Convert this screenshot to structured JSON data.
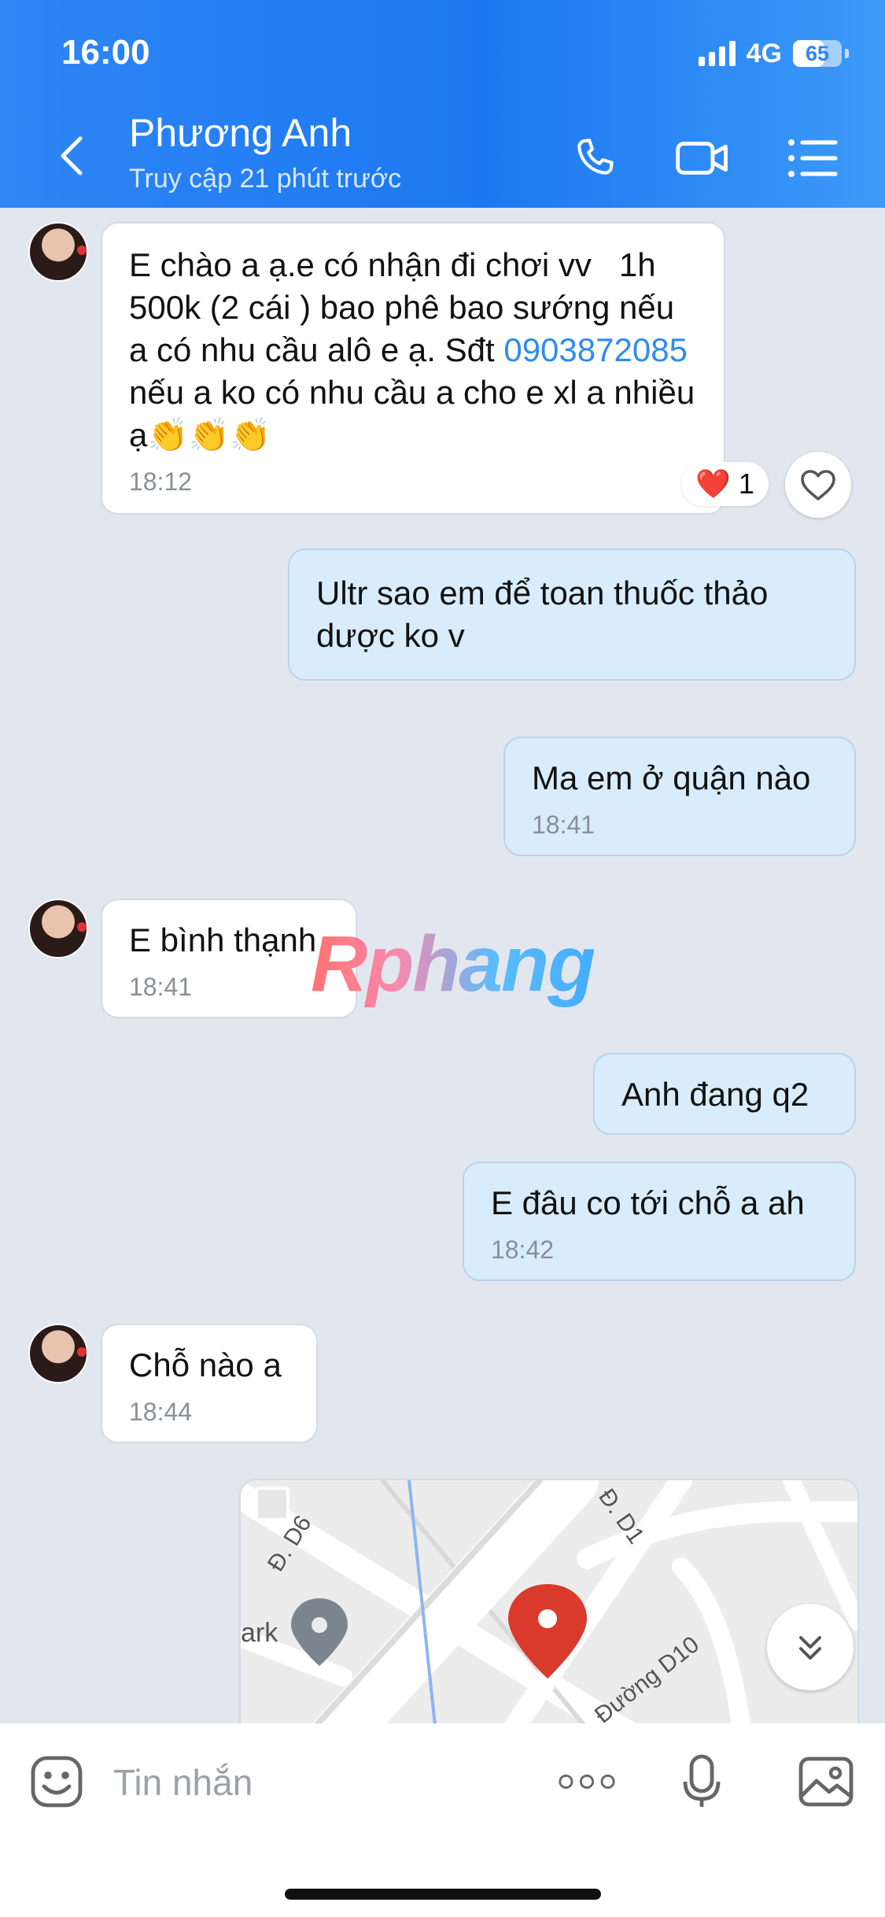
{
  "status_bar": {
    "time": "16:00",
    "network": "4G",
    "battery": "65",
    "battery_fraction": 0.65
  },
  "header": {
    "contact_name": "Phương Anh",
    "contact_status": "Truy cập 21 phút trước"
  },
  "messages": [
    {
      "direction": "in",
      "text_before": "E chào a ạ.e có nhận đi chơi vv   1h 500k (2 cái ) bao phê bao sướng nếu a có nhu cầu alô e ạ. Sđt ",
      "phone": "0903872085",
      "text_after": "  nếu a ko có nhu cầu a cho e xl a nhiều ạ👏👏👏",
      "time": "18:12"
    },
    {
      "direction": "out",
      "text": "Ultr sao em để toan thuốc thảo dược ko v",
      "reaction": {
        "emoji": "❤️",
        "count": "1"
      }
    },
    {
      "direction": "out",
      "text": "Ma em ở quận nào",
      "time": "18:41"
    },
    {
      "direction": "in",
      "text": "E bình thạnh",
      "time": "18:41"
    },
    {
      "direction": "out",
      "text": "Anh đang q2"
    },
    {
      "direction": "out",
      "text": "E đâu co tới chỗ a ah",
      "time": "18:42"
    },
    {
      "direction": "in",
      "text": "Chỗ nào a",
      "time": "18:44"
    }
  ],
  "map": {
    "labels": {
      "d6": "Đ. D6",
      "d1": "Đ. D1",
      "d10": "Đường D10",
      "park": "ark"
    }
  },
  "watermark": "Rphang",
  "composer": {
    "placeholder": "Tin nhắn"
  },
  "colors": {
    "header_blue": "#1c78f2",
    "outgoing_bubble": "#d8ecfb",
    "chat_bg": "#e2e6ee",
    "link": "#2d8cf0",
    "pin_red": "#d93a2b"
  },
  "icons": [
    "back-arrow-icon",
    "phone-icon",
    "video-call-icon",
    "menu-list-icon",
    "heart-icon",
    "chevron-double-down-icon",
    "emoji-icon",
    "more-dots-icon",
    "microphone-icon",
    "image-gallery-icon",
    "location-pin-icon"
  ]
}
